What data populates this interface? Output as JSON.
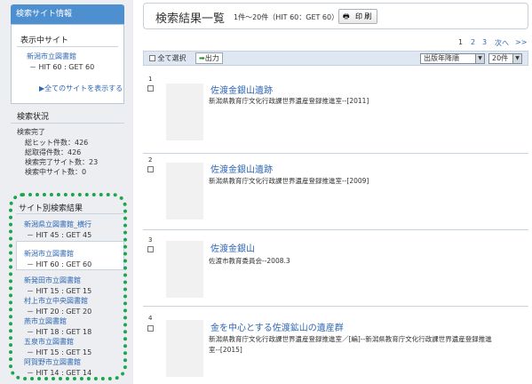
{
  "sidebar": {
    "header": "検索サイト情報",
    "current_site": {
      "title": "表示中サイト",
      "site_name": "新潟市立図書館",
      "site_hits": "－ HIT 60 : GET 60",
      "show_all": "▶全てのサイトを表示する"
    },
    "status": {
      "title": "検索状況",
      "state": "検索完了",
      "lines": [
        "総ヒット件数：426",
        "総取得件数：426",
        "検索完了サイト数：23",
        "検索中サイト数：0"
      ]
    },
    "by_site": {
      "title": "サイト別検索結果",
      "items": [
        {
          "name": "新潟県立図書館_横行",
          "hits": "－ HIT 45 : GET 45"
        },
        {
          "name": "新潟市立図書館",
          "hits": "－ HIT 60 : GET 60"
        },
        {
          "name": "新発田市立図書館",
          "hits": "－ HIT 15 : GET 15"
        },
        {
          "name": "村上市立中央図書館",
          "hits": "－ HIT 20 : GET 20"
        },
        {
          "name": "燕市立図書館",
          "hits": "－ HIT 18 : GET 18"
        },
        {
          "name": "五泉市立図書館",
          "hits": "－ HIT 15 : GET 15"
        },
        {
          "name": "阿賀野市立図書館",
          "hits": "－ HIT 14 : GET 14"
        }
      ]
    }
  },
  "main": {
    "title": "検索結果一覧",
    "count": "1件～20件（HIT 60：GET 60）",
    "print": "印 刷",
    "pager": {
      "pages": [
        "1",
        "2",
        "3"
      ],
      "next": "次へ",
      "last": ">>"
    },
    "toolbar": {
      "select_all": "全て選択",
      "output": "出力",
      "sort_value": "出版年降順",
      "per_page_value": "20件"
    },
    "results": [
      {
        "number": "1",
        "title": "佐渡金銀山遺跡",
        "meta": "新潟県教育庁文化行政課世界遺産登録推進室--[2011]"
      },
      {
        "number": "2",
        "title": "佐渡金銀山遺跡",
        "meta": "新潟県教育庁文化行政課世界遺産登録推進室--[2009]"
      },
      {
        "number": "3",
        "title": "佐渡金銀山",
        "meta": "佐渡市教育委員会--2008.3"
      },
      {
        "number": "4",
        "title": "金を中心とする佐渡鉱山の遺産群",
        "meta": "新潟県教育庁文化行政課世界遺産登録推進室／[編]--新潟県教育庁文化行政課世界遺産登録推進",
        "meta2": "室--[2015]"
      }
    ]
  }
}
